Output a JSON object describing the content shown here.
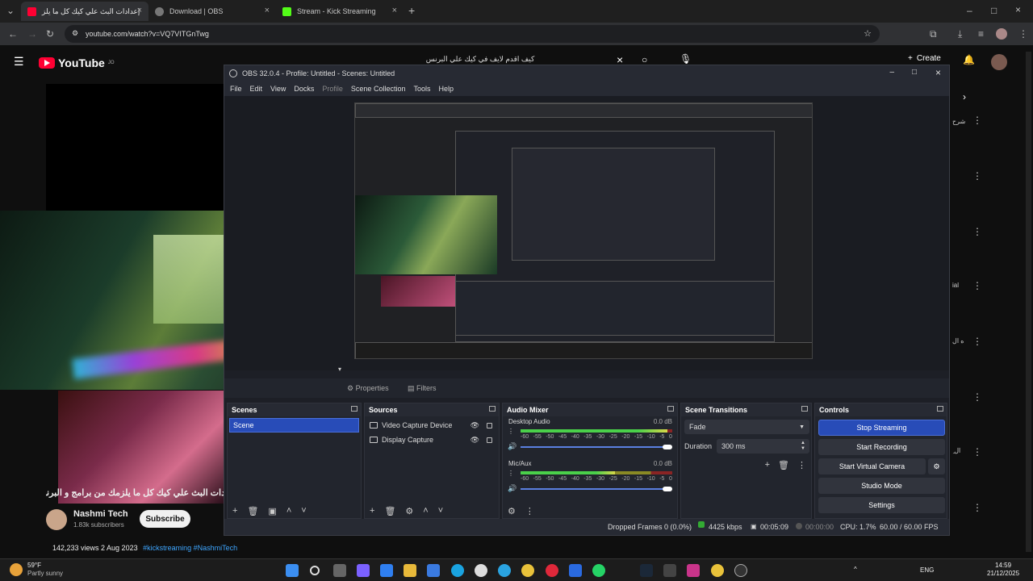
{
  "browser": {
    "tabs": [
      {
        "label": "إعدادات البث علي كيك كل ما يلز",
        "active": true,
        "favicon_color": "#ff0033"
      },
      {
        "label": "Download | OBS",
        "active": false,
        "favicon_color": "#888888"
      },
      {
        "label": "Stream - Kick Streaming",
        "active": false,
        "favicon_color": "#53fc18"
      }
    ],
    "new_tab": "+",
    "url": "youtube.com/watch?v=VQ7VITGnTwg"
  },
  "youtube": {
    "logo": "YouTube",
    "logo_badge": "JO",
    "search_text": "كيف اقدم لايف في كيك علي البرنس",
    "create_label": "Create",
    "video_title": "دات البث علي كيك كل ما يلزمك من برامج و البرنامج",
    "channel_name": "Nashmi Tech",
    "subscribers": "1.83k subscribers",
    "subscribe_label": "Subscribe",
    "views_date": "142,233 views  2 Aug 2023",
    "hashtags": "#kickstreaming #NashmiTech",
    "right_snippets": [
      "شرح",
      "ial",
      "ه ال",
      "ِ ال"
    ]
  },
  "obs": {
    "title": "OBS 32.0.4 - Profile: Untitled - Scenes: Untitled",
    "menu": [
      "File",
      "Edit",
      "View",
      "Docks",
      "Profile",
      "Scene Collection",
      "Tools",
      "Help"
    ],
    "properties_label": "Properties",
    "filters_label": "Filters",
    "scenes": {
      "title": "Scenes",
      "items": [
        "Scene"
      ]
    },
    "sources": {
      "title": "Sources",
      "items": [
        "Video Capture Device",
        "Display Capture"
      ]
    },
    "audio_mixer": {
      "title": "Audio Mixer",
      "channels": [
        {
          "name": "Desktop Audio",
          "db": "0.0 dB",
          "level": 0.97
        },
        {
          "name": "Mic/Aux",
          "db": "0.0 dB",
          "level": 0.62
        }
      ],
      "ticks": [
        "-60",
        "-55",
        "-50",
        "-45",
        "-40",
        "-35",
        "-30",
        "-25",
        "-20",
        "-15",
        "-10",
        "-5",
        "0"
      ]
    },
    "scene_transitions": {
      "title": "Scene Transitions",
      "transition": "Fade",
      "duration_label": "Duration",
      "duration": "300 ms"
    },
    "controls": {
      "title": "Controls",
      "buttons": [
        "Stop Streaming",
        "Start Recording",
        "Start Virtual Camera",
        "Studio Mode",
        "Settings"
      ]
    },
    "status": {
      "dropped": "Dropped Frames 0 (0.0%)",
      "bitrate": "4425 kbps",
      "stream_time": "00:05:09",
      "rec_time": "00:00:00",
      "cpu": "CPU: 1.7%",
      "fps": "60.00 / 60.00 FPS"
    }
  },
  "taskbar": {
    "weather_temp": "59°F",
    "weather_desc": "Partly sunny",
    "lang": "ENG",
    "time": "14:59",
    "date": "21/12/2025"
  }
}
